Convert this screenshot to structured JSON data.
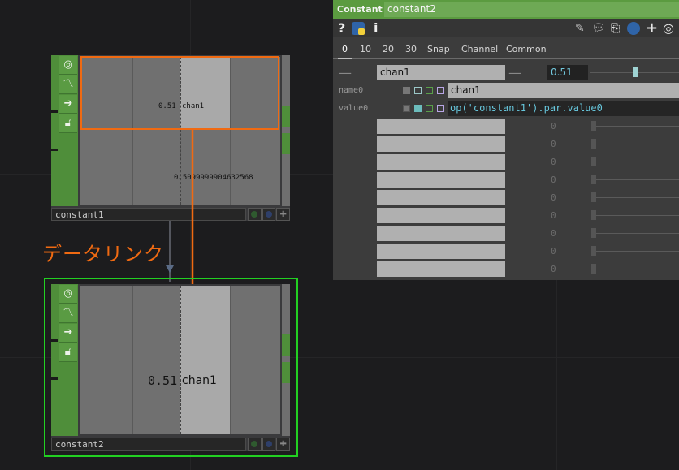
{
  "node1": {
    "name": "constant1",
    "value": "0.51",
    "channel": "chan1",
    "expr_value": "0.5099999904632568",
    "icons": [
      "viewer-icon",
      "bypass-icon",
      "export-icon",
      "lock-icon"
    ]
  },
  "node2": {
    "name": "constant2",
    "value": "0.51",
    "channel": "chan1",
    "icons": [
      "viewer-icon",
      "bypass-icon",
      "export-icon",
      "lock-icon"
    ]
  },
  "annotation": {
    "label": "データリンク",
    "color": "#f06a12"
  },
  "panel": {
    "op_type": "Constant",
    "op_name": "constant2",
    "header_icons": [
      "help-icon",
      "python-icon",
      "info-icon",
      "edit-icon",
      "comment-icon",
      "clone-icon",
      "python-script-icon",
      "add-icon",
      "target-icon"
    ],
    "tabs": [
      "0",
      "10",
      "20",
      "30",
      "Snap",
      "Channel",
      "Common"
    ],
    "active_tab": "0",
    "row0": {
      "name": "chan1",
      "value": "0.51",
      "slider_fraction": 0.51
    },
    "name0": {
      "label": "name0",
      "value": "chan1"
    },
    "value0": {
      "label": "value0",
      "expression": "op('constant1').par.value0"
    },
    "empty_rows": [
      {
        "value": "0"
      },
      {
        "value": "0"
      },
      {
        "value": "0"
      },
      {
        "value": "0"
      },
      {
        "value": "0"
      },
      {
        "value": "0"
      },
      {
        "value": "0"
      },
      {
        "value": "0"
      },
      {
        "value": "0"
      }
    ]
  },
  "colors": {
    "accent_green": "#5b9b40",
    "selected_outline": "#22d022",
    "link_orange": "#f06a12",
    "expression_cyan": "#67c7dd"
  }
}
